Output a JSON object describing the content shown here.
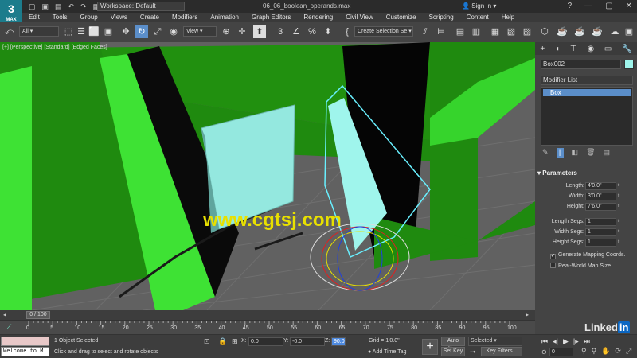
{
  "app": {
    "logo_text": "3",
    "logo_sub": "MAX",
    "title": "06_06_boolean_operands.max",
    "workspace": "Workspace: Default",
    "signin": "Sign In"
  },
  "menu": [
    "Edit",
    "Tools",
    "Group",
    "Views",
    "Create",
    "Modifiers",
    "Animation",
    "Graph Editors",
    "Rendering",
    "Civil View",
    "Customize",
    "Scripting",
    "Content",
    "Help"
  ],
  "toolbar": {
    "filter": "All",
    "ref_coord": "View",
    "selection_set": "Create Selection Se"
  },
  "viewport": {
    "label": "[+] [Perspective] [Standard] [Edged Faces]",
    "watermark": "www.cgtsj.com",
    "colors": {
      "wall": "#1f8a0f",
      "wall_light": "#3bdc31",
      "selected_box": "#9ff5ec",
      "floor": "#616161"
    }
  },
  "command_panel": {
    "object_name": "Box002",
    "object_color": "#9ff5ec",
    "modifier_list": "Modifier List",
    "stack_item": "Box",
    "params_title": "Parameters",
    "params": [
      {
        "label": "Length:",
        "value": "4'0.0\""
      },
      {
        "label": "Width:",
        "value": "3'0.0\""
      },
      {
        "label": "Height:",
        "value": "7'6.0\""
      },
      {
        "label": "Length Segs:",
        "value": "1"
      },
      {
        "label": "Width Segs:",
        "value": "1"
      },
      {
        "label": "Height Segs:",
        "value": "1"
      }
    ],
    "gen_mapping": "Generate Mapping Coords.",
    "real_world": "Real-World Map Size"
  },
  "timeline": {
    "current": "0 / 100",
    "ticks": [
      "0",
      "5",
      "10",
      "15",
      "20",
      "25",
      "30",
      "35",
      "40",
      "45",
      "50",
      "55",
      "60",
      "65",
      "70",
      "75",
      "80",
      "85",
      "90",
      "95",
      "100"
    ]
  },
  "status": {
    "maxscript": "Welcome to M",
    "objects_selected": "1 Object Selected",
    "prompt": "Click and drag to select and rotate objects",
    "x_label": "X:",
    "x": "0.0",
    "y_label": "Y:",
    "y": "-0.0",
    "z_label": "Z:",
    "z": "90.0",
    "grid": "Grid = 1'0.0\"",
    "add_time_tag": "Add Time Tag",
    "auto_key": "Auto Key",
    "set_key": "Set Key",
    "selected": "Selected",
    "key_filters": "Key Filters...",
    "frame": "0",
    "linkedin": "Linked in"
  }
}
